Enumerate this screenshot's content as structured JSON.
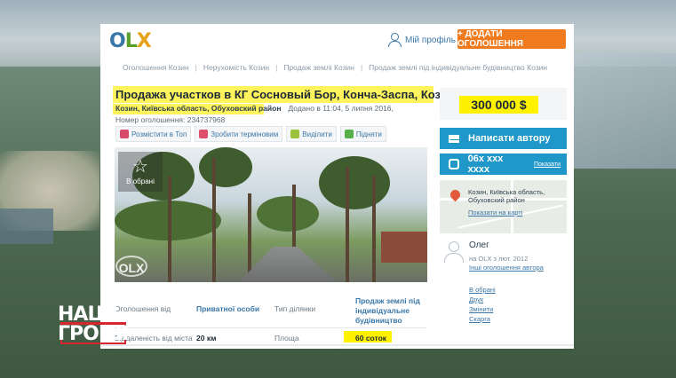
{
  "header": {
    "logo": {
      "o": "O",
      "l": "L",
      "x": "X"
    },
    "profile_label": "Мій профіль",
    "add_button_label": "+ ДОДАТИ ОГОЛОШЕННЯ"
  },
  "breadcrumb": [
    "Оголошення Козин",
    "Нерухомість Козин",
    "Продаж землі Козин",
    "Продаж землі під індивідуальне будівництво Козин"
  ],
  "listing": {
    "title": "Продажа участков в КГ Сосновый Бор, Конча-Заспа, Козин",
    "location": "Козин, Київська область, Обуховский район",
    "date": "Додано в 11:04, 5 липня 2016,",
    "ad_number": "Номер оголошення: 234737968",
    "price": "300 000 $"
  },
  "actions": [
    {
      "label": "Розмістити в Топ",
      "color": "#d84a6a"
    },
    {
      "label": "Зробити терміновим",
      "color": "#e0506e"
    },
    {
      "label": "Виділити",
      "color": "#9bc23c"
    },
    {
      "label": "Підняти",
      "color": "#57b04a"
    }
  ],
  "photo": {
    "favorite_label": "В обрані",
    "watermark": "OLX"
  },
  "details": {
    "row1": {
      "k1": "Оголошення від",
      "v1": "Приватної особи",
      "k2": "Тип ділянки",
      "v2": "Продаж землі під індивідуальне будівництво"
    },
    "row2": {
      "k1": "Віддаленість від міста",
      "v1": "20 км",
      "k2": "Площа",
      "v2": "60 соток"
    }
  },
  "sidebar": {
    "message_button": "Написати автору",
    "phone_number": "06x xxx xxxx",
    "phone_show": "Показати",
    "map_text": "Козин, Київська область, Обуховский район",
    "map_link": "Показати на карті",
    "seller_name": "Олег",
    "seller_since": "на OLX з лют. 2012",
    "seller_link": "Інші оголошення автора",
    "links": [
      "В обрані",
      "Друк",
      "Змінити",
      "Скарга"
    ]
  },
  "channel_logo": {
    "top": "НАШІ",
    "bottom": "ГРОШІ"
  },
  "colors": {
    "accent_blue": "#1f97c8",
    "orange": "#f07b1f",
    "highlight_yellow": "#fff200",
    "link": "#3a77a8"
  }
}
